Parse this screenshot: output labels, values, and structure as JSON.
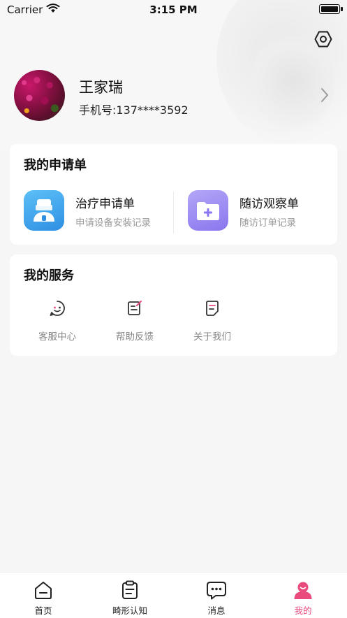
{
  "status_bar": {
    "carrier": "Carrier",
    "time": "3:15 PM"
  },
  "profile": {
    "name": "王家瑞",
    "phone": "手机号:137****3592"
  },
  "applications": {
    "title": "我的申请单",
    "items": [
      {
        "title": "治疗申请单",
        "subtitle": "申请设备安装记录",
        "icon": "doctor-icon",
        "color": "#3aa0ea"
      },
      {
        "title": "随访观察单",
        "subtitle": "随访订单记录",
        "icon": "folder-plus-icon",
        "color": "#9f8cf2"
      }
    ]
  },
  "services": {
    "title": "我的服务",
    "items": [
      {
        "label": "客服中心",
        "icon": "customer-service-icon"
      },
      {
        "label": "帮助反馈",
        "icon": "feedback-icon"
      },
      {
        "label": "关于我们",
        "icon": "about-icon"
      }
    ]
  },
  "tabbar": {
    "items": [
      {
        "label": "首页",
        "icon": "home-icon"
      },
      {
        "label": "畸形认知",
        "icon": "notes-icon"
      },
      {
        "label": "消息",
        "icon": "message-icon"
      },
      {
        "label": "我的",
        "icon": "profile-icon",
        "active": true
      }
    ]
  },
  "colors": {
    "accent": "#e94b7d",
    "background": "#f6f6f7"
  }
}
